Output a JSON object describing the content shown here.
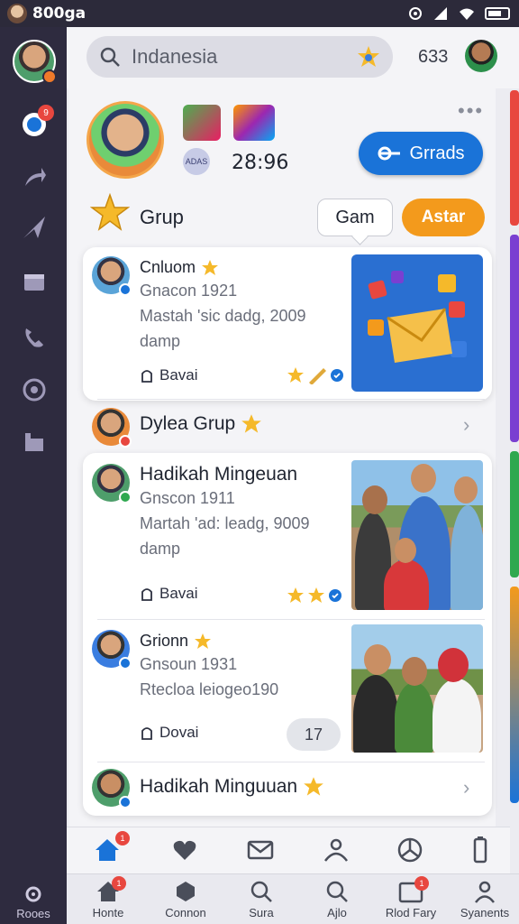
{
  "status_bar": {
    "time": "800ga"
  },
  "search": {
    "text": "Indanesia"
  },
  "top": {
    "count": "633"
  },
  "header": {
    "time_value": "28:96",
    "small_badge": "ADAS",
    "grads_label": "Grrads"
  },
  "section": {
    "title": "Grup",
    "gam_label": "Gam",
    "astar_label": "Astar"
  },
  "cards": [
    {
      "name": "Cnluom",
      "sub": "Gnacon 1921",
      "desc": "Mastah 'sic dadg, 2009 damp",
      "action": "Bavai"
    },
    {
      "name": "Dylea Grup"
    },
    {
      "name": "Hadikah Mingeuan",
      "sub": "Gnscon 1911",
      "desc": "Martah 'ad: leadg, 9009 damp",
      "action": "Bavai"
    },
    {
      "name": "Grionn",
      "sub": "Gnsoun 1931",
      "desc": "Rtecloa leiogeo190",
      "action": "Dovai",
      "pill": "17"
    },
    {
      "name": "Hadikah Minguuan"
    }
  ],
  "rail": {
    "bottom_label": "Rooes",
    "notif_count": "9"
  },
  "tabbar": {
    "badge": "1",
    "items": [
      {
        "label": "Honte"
      },
      {
        "label": "Connon"
      },
      {
        "label": "Sura"
      },
      {
        "label": "Ajlo"
      },
      {
        "label": "Rlod Fary"
      },
      {
        "label": "Syanents"
      }
    ]
  },
  "colors": {
    "accent_blue": "#1a73d8",
    "accent_orange": "#f39a1c",
    "rail_bg": "#2e2b3f",
    "badge_red": "#e8473f"
  }
}
